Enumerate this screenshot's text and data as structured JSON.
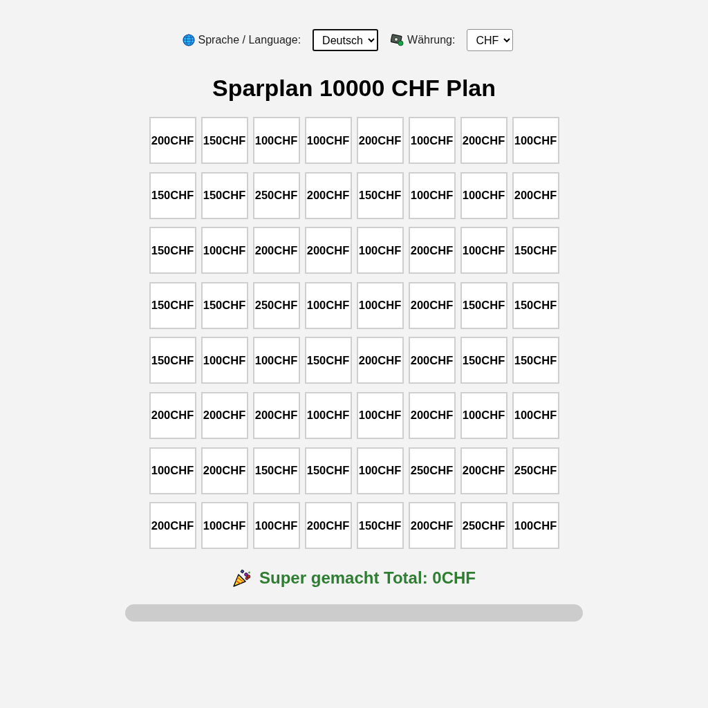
{
  "language_picker": {
    "label": "Sprache / Language:",
    "value": "Deutsch",
    "focused": true
  },
  "currency_picker": {
    "label": "Währung:",
    "value": "CHF",
    "focused": false
  },
  "title": "Sparplan 10000 CHF Plan",
  "tiles": [
    {
      "amount": "200CHF",
      "checked": false
    },
    {
      "amount": "150CHF",
      "checked": false
    },
    {
      "amount": "100CHF",
      "checked": false
    },
    {
      "amount": "100CHF",
      "checked": false
    },
    {
      "amount": "200CHF",
      "checked": false
    },
    {
      "amount": "100CHF",
      "checked": false
    },
    {
      "amount": "200CHF",
      "checked": false
    },
    {
      "amount": "100CHF",
      "checked": false
    },
    {
      "amount": "150CHF",
      "checked": false
    },
    {
      "amount": "150CHF",
      "checked": false
    },
    {
      "amount": "250CHF",
      "checked": false
    },
    {
      "amount": "200CHF",
      "checked": false
    },
    {
      "amount": "150CHF",
      "checked": false
    },
    {
      "amount": "100CHF",
      "checked": false
    },
    {
      "amount": "100CHF",
      "checked": false
    },
    {
      "amount": "200CHF",
      "checked": false
    },
    {
      "amount": "150CHF",
      "checked": false
    },
    {
      "amount": "100CHF",
      "checked": false
    },
    {
      "amount": "200CHF",
      "checked": false
    },
    {
      "amount": "200CHF",
      "checked": false
    },
    {
      "amount": "100CHF",
      "checked": false
    },
    {
      "amount": "200CHF",
      "checked": false
    },
    {
      "amount": "100CHF",
      "checked": false
    },
    {
      "amount": "150CHF",
      "checked": false
    },
    {
      "amount": "150CHF",
      "checked": false
    },
    {
      "amount": "150CHF",
      "checked": false
    },
    {
      "amount": "250CHF",
      "checked": false
    },
    {
      "amount": "100CHF",
      "checked": false
    },
    {
      "amount": "100CHF",
      "checked": false
    },
    {
      "amount": "200CHF",
      "checked": false
    },
    {
      "amount": "150CHF",
      "checked": false
    },
    {
      "amount": "150CHF",
      "checked": false
    },
    {
      "amount": "150CHF",
      "checked": false
    },
    {
      "amount": "100CHF",
      "checked": false
    },
    {
      "amount": "100CHF",
      "checked": false
    },
    {
      "amount": "150CHF",
      "checked": false
    },
    {
      "amount": "200CHF",
      "checked": false
    },
    {
      "amount": "200CHF",
      "checked": false
    },
    {
      "amount": "150CHF",
      "checked": false
    },
    {
      "amount": "150CHF",
      "checked": false
    },
    {
      "amount": "200CHF",
      "checked": false
    },
    {
      "amount": "200CHF",
      "checked": false
    },
    {
      "amount": "200CHF",
      "checked": false
    },
    {
      "amount": "100CHF",
      "checked": false
    },
    {
      "amount": "100CHF",
      "checked": false
    },
    {
      "amount": "200CHF",
      "checked": false
    },
    {
      "amount": "100CHF",
      "checked": false
    },
    {
      "amount": "100CHF",
      "checked": false
    },
    {
      "amount": "100CHF",
      "checked": false
    },
    {
      "amount": "200CHF",
      "checked": false
    },
    {
      "amount": "150CHF",
      "checked": false
    },
    {
      "amount": "150CHF",
      "checked": false
    },
    {
      "amount": "100CHF",
      "checked": false
    },
    {
      "amount": "250CHF",
      "checked": false
    },
    {
      "amount": "200CHF",
      "checked": false
    },
    {
      "amount": "250CHF",
      "checked": false
    },
    {
      "amount": "200CHF",
      "checked": false
    },
    {
      "amount": "100CHF",
      "checked": false
    },
    {
      "amount": "100CHF",
      "checked": false
    },
    {
      "amount": "200CHF",
      "checked": false
    },
    {
      "amount": "150CHF",
      "checked": false
    },
    {
      "amount": "200CHF",
      "checked": false
    },
    {
      "amount": "250CHF",
      "checked": false
    },
    {
      "amount": "100CHF",
      "checked": false
    }
  ],
  "total_message": "Super gemacht Total: 0CHF",
  "progress": {
    "level": 0
  }
}
